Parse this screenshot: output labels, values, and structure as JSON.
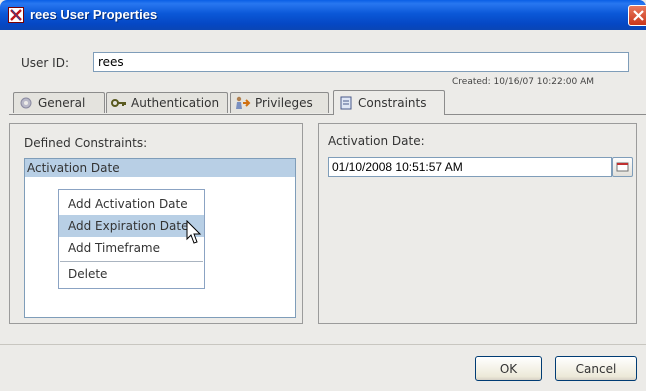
{
  "window": {
    "title": "rees User Properties"
  },
  "user": {
    "id_label": "User ID:",
    "id_value": "rees",
    "created_text": "Created: 10/16/07 10:22:00 AM"
  },
  "tabs": [
    {
      "label": "General",
      "icon": "general-icon",
      "active": false
    },
    {
      "label": "Authentication",
      "icon": "key-icon",
      "active": false
    },
    {
      "label": "Privileges",
      "icon": "privileges-icon",
      "active": false
    },
    {
      "label": "Constraints",
      "icon": "constraints-icon",
      "active": true
    }
  ],
  "constraints": {
    "list_label": "Defined Constraints:",
    "items": [
      "Activation Date"
    ]
  },
  "context_menu": {
    "items": [
      {
        "label": "Add Activation Date",
        "highlighted": false
      },
      {
        "label": "Add Expiration Date",
        "highlighted": true
      },
      {
        "label": "Add Timeframe",
        "highlighted": false
      },
      {
        "label": "Delete",
        "highlighted": false
      }
    ]
  },
  "detail": {
    "label": "Activation Date:",
    "date_value": "01/10/2008 10:51:57 AM"
  },
  "buttons": {
    "ok": "OK",
    "cancel": "Cancel"
  },
  "colors": {
    "titlebar": "#0547c4",
    "selection": "#b8cfe5",
    "field_border": "#7f9db9"
  }
}
